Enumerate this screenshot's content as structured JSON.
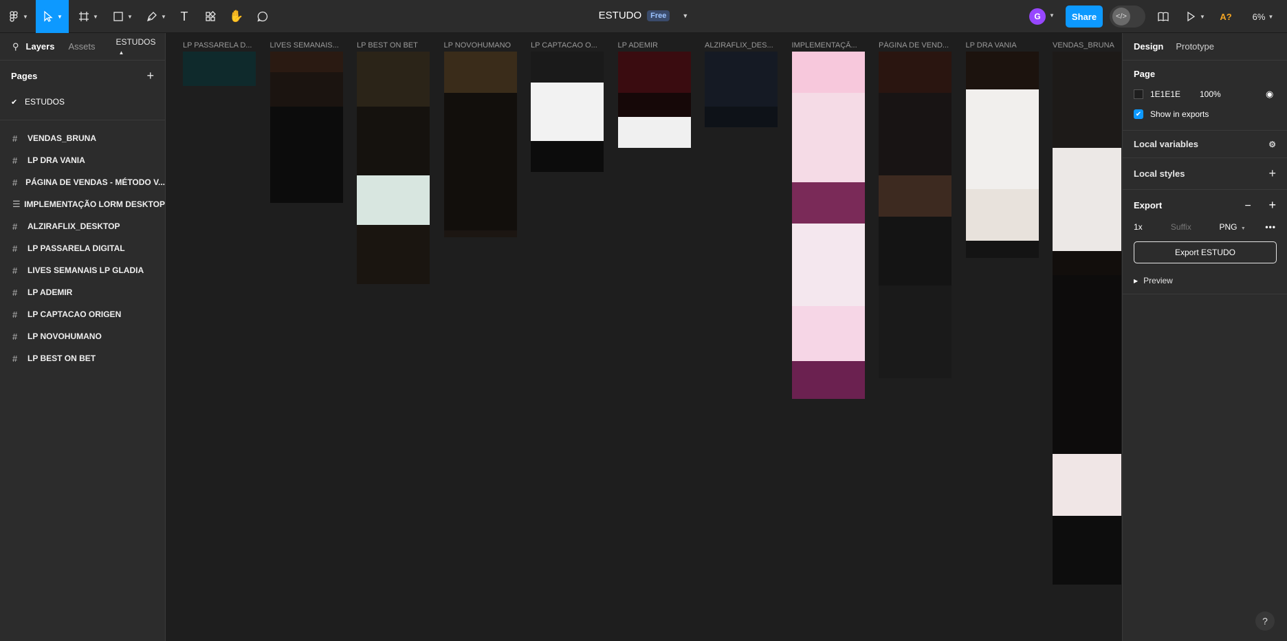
{
  "toolbar": {
    "file_name": "ESTUDO",
    "plan_badge": "Free",
    "share_label": "Share",
    "user_initial": "G",
    "ai_label": "A?",
    "zoom": "6%",
    "accent": "#0d99ff"
  },
  "left_panel": {
    "tabs": [
      "Layers",
      "Assets"
    ],
    "page_selector": "ESTUDOS",
    "pages_label": "Pages",
    "pages": [
      {
        "name": "ESTUDOS",
        "checked": true
      }
    ],
    "layers": [
      {
        "name": "VENDAS_BRUNA",
        "icon": "frame-icon"
      },
      {
        "name": "LP DRA VANIA",
        "icon": "frame-icon"
      },
      {
        "name": "PÁGINA DE VENDAS - MÉTODO V...",
        "icon": "frame-icon"
      },
      {
        "name": "IMPLEMENTAÇÃO LORM DESKTOP",
        "icon": "section-icon"
      },
      {
        "name": "ALZIRAFLIX_DESKTOP",
        "icon": "frame-icon"
      },
      {
        "name": "LP PASSARELA DIGITAL",
        "icon": "frame-icon"
      },
      {
        "name": "LIVES SEMANAIS LP GLADIA",
        "icon": "frame-icon"
      },
      {
        "name": "LP ADEMIR",
        "icon": "frame-icon"
      },
      {
        "name": "LP CAPTACAO ORIGEN",
        "icon": "frame-icon"
      },
      {
        "name": "LP NOVOHUMANO",
        "icon": "frame-icon"
      },
      {
        "name": "LP BEST ON BET",
        "icon": "frame-icon"
      }
    ]
  },
  "canvas": {
    "frames": [
      {
        "label": "LP PASSARELA D...",
        "blocks": [
          [
            "#0f2a2c",
            50
          ]
        ]
      },
      {
        "label": "LIVES SEMANAIS...",
        "blocks": [
          [
            "#2a1a12",
            30
          ],
          [
            "#1b1410",
            50
          ],
          [
            "#0c0c0c",
            140
          ]
        ]
      },
      {
        "label": "LP BEST ON BET",
        "blocks": [
          [
            "#2b2418",
            80
          ],
          [
            "#15120e",
            100
          ],
          [
            "#d8e6e0",
            72
          ],
          [
            "#1a1510",
            86
          ]
        ]
      },
      {
        "label": "LP NOVOHUMANO",
        "blocks": [
          [
            "#3a2c1a",
            60
          ],
          [
            "#120f0c",
            200
          ],
          [
            "#1c1612",
            10
          ]
        ]
      },
      {
        "label": "LP CAPTACAO O...",
        "blocks": [
          [
            "#1a1a1a",
            45
          ],
          [
            "#f2f2f2",
            85
          ],
          [
            "#0c0c0c",
            45
          ]
        ]
      },
      {
        "label": "LP ADEMIR",
        "blocks": [
          [
            "#3a0c10",
            60
          ],
          [
            "#160808",
            35
          ],
          [
            "#f0f0f0",
            45
          ]
        ]
      },
      {
        "label": "ALZIRAFLIX_DES...",
        "blocks": [
          [
            "#151a24",
            80
          ],
          [
            "#0e1218",
            30
          ]
        ]
      },
      {
        "label": "IMPLEMENTAÇÃ...",
        "blocks": [
          [
            "#f7c8dc",
            60
          ],
          [
            "#f5dbe6",
            130
          ],
          [
            "#7a2a58",
            60
          ],
          [
            "#f4e7ee",
            120
          ],
          [
            "#f6d6e6",
            80
          ],
          [
            "#6b2150",
            55
          ]
        ]
      },
      {
        "label": "PÁGINA DE VEND...",
        "blocks": [
          [
            "#2a1510",
            60
          ],
          [
            "#181414",
            120
          ],
          [
            "#3d2a20",
            60
          ],
          [
            "#141414",
            100
          ],
          [
            "#1a1a1a",
            135
          ]
        ]
      },
      {
        "label": "LP DRA VANIA",
        "blocks": [
          [
            "#1c130e",
            55
          ],
          [
            "#f1efed",
            145
          ],
          [
            "#e8e2dc",
            75
          ],
          [
            "#141414",
            25
          ]
        ]
      },
      {
        "label": "VENDAS_BRUNA",
        "blocks": [
          [
            "#1d1a18",
            140
          ],
          [
            "#ece8e6",
            150
          ],
          [
            "#120e0c",
            35
          ],
          [
            "#0d0c0c",
            260
          ],
          [
            "#f0e6e6",
            90
          ],
          [
            "#0d0d0d",
            100
          ]
        ]
      }
    ]
  },
  "right_panel": {
    "tabs": [
      "Design",
      "Prototype"
    ],
    "page_section": "Page",
    "bg_hex": "1E1E1E",
    "bg_opacity": "100%",
    "show_in_exports": "Show in exports",
    "local_variables": "Local variables",
    "local_styles": "Local styles",
    "export_section": "Export",
    "export_scale": "1x",
    "export_suffix_placeholder": "Suffix",
    "export_format": "PNG",
    "export_button": "Export ESTUDO",
    "preview": "Preview"
  },
  "help": "?"
}
